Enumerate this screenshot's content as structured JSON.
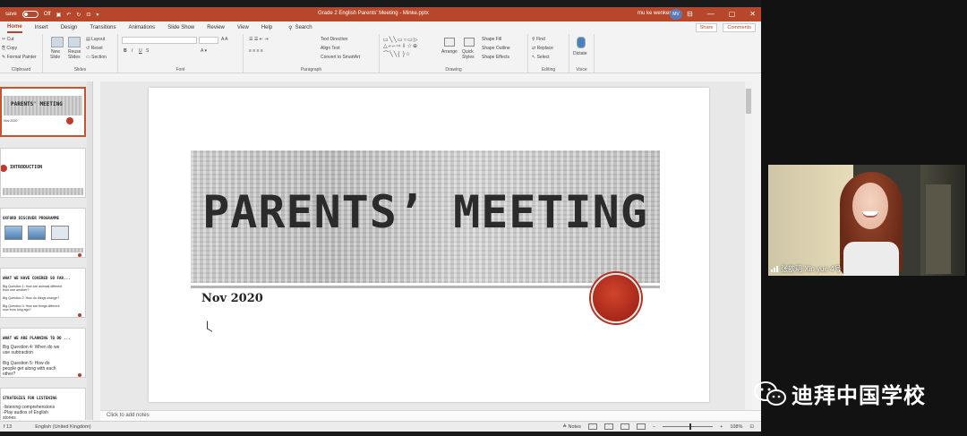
{
  "window": {
    "autosave_label": "save",
    "autosave_state": "Off",
    "title": "Grade 2 English Parents' Meeting - Minke.pptx",
    "user_name": "mu ke wenker",
    "user_initials": "MV",
    "min": "—",
    "max": "▢",
    "close": "✕"
  },
  "tabs": [
    "Home",
    "Insert",
    "Design",
    "Transitions",
    "Animations",
    "Slide Show",
    "Review",
    "View",
    "Help"
  ],
  "search_label": "Search",
  "share_label": "Share",
  "comments_label": "Comments",
  "ribbon": {
    "clipboard": {
      "name": "Clipboard",
      "cut": "Cut",
      "copy": "Copy",
      "format_painter": "Format Painter"
    },
    "slides": {
      "name": "Slides",
      "new": "New",
      "slide": "Slide",
      "reuse": "Reuse",
      "slides": "Slides",
      "layout": "Layout",
      "reset": "Reset",
      "section": "Section"
    },
    "font": {
      "name": "Font"
    },
    "paragraph": {
      "name": "Paragraph",
      "text_direction": "Text Direction",
      "align_text": "Align Text",
      "smartart": "Convert to SmartArt"
    },
    "drawing": {
      "name": "Drawing",
      "arrange": "Arrange",
      "quick": "Quick",
      "styles": "Styles",
      "shape_fill": "Shape Fill",
      "shape_outline": "Shape Outline",
      "shape_effects": "Shape Effects"
    },
    "editing": {
      "name": "Editing",
      "find": "Find",
      "replace": "Replace",
      "select": "Select"
    },
    "voice": {
      "name": "Voice",
      "dictate": "Dictate"
    }
  },
  "thumbnails": [
    {
      "title": "PARENTS' MEETING",
      "text": "Nov 2020"
    },
    {
      "title": "INTRODUCTION",
      "text": ""
    },
    {
      "title": "OXFORD DISCOVER PROGRAMME",
      "text": ""
    },
    {
      "title": "WHAT WE HAVE COVERED SO FAR...",
      "text": "Big Question 1: How are animals different\nfrom one another?\n\nBig Question 2: How do things change?\n\nBig Question 3: How are things different\nnow from long ago?"
    },
    {
      "title": "WHAT WE ARE PLANNING TO DO ...",
      "text": "Big Question 4: When do we\nuse subtraction\n\nBig Question 5: How do\npeople get along with each\nother?"
    },
    {
      "title": "STRATEGIES FOR LISTENING",
      "text": "-listening comprehensions\n-Play audios of English\nstories\n-Watch videos or movies on"
    }
  ],
  "slide": {
    "title": "PARENTS’ MEETING",
    "subtitle": "Nov 2020"
  },
  "notes_placeholder": "Click to add notes",
  "status": {
    "slide_num": "f 13",
    "language": "English (United Kingdom)",
    "notes_label": "Notes",
    "zoom": "108%"
  },
  "video": {
    "participant": "张歆玥 Xin yue 4号"
  },
  "watermark": {
    "text": "迪拜中国学校"
  }
}
